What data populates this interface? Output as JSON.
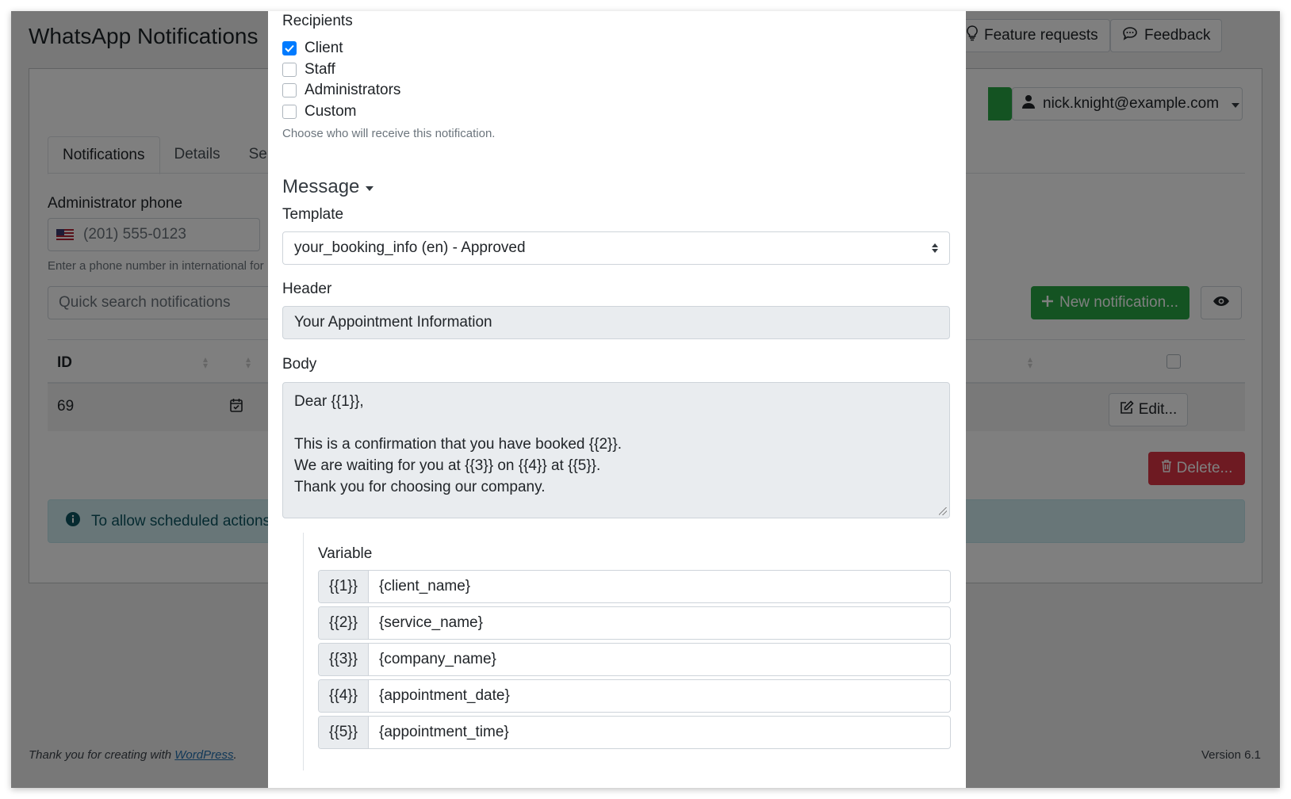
{
  "page": {
    "title": "WhatsApp Notifications",
    "feature_requests": "Feature requests",
    "feedback": "Feedback",
    "user_email": "nick.knight@example.com",
    "tabs": [
      {
        "label": "Notifications"
      },
      {
        "label": "Details"
      },
      {
        "label": "Se"
      }
    ],
    "admin_phone_label": "Administrator phone",
    "admin_phone_placeholder": "(201) 555-0123",
    "phone_help": "Enter a phone number in international for",
    "quick_search_placeholder": "Quick search notifications",
    "new_notification": "New notification...",
    "table": {
      "id_header": "ID",
      "rows": [
        {
          "id": "69",
          "edit": "Edit..."
        }
      ]
    },
    "delete": "Delete...",
    "alert_text": "To allow scheduled actions",
    "footer_text": "Thank you for creating with ",
    "footer_link": "WordPress",
    "footer_period": ".",
    "version": "Version 6.1"
  },
  "modal": {
    "recipients_label": "Recipients",
    "recipients": [
      {
        "label": "Client",
        "checked": true
      },
      {
        "label": "Staff",
        "checked": false
      },
      {
        "label": "Administrators",
        "checked": false
      },
      {
        "label": "Custom",
        "checked": false
      }
    ],
    "recipients_help": "Choose who will receive this notification.",
    "message_title": "Message",
    "template_label": "Template",
    "template_value": "your_booking_info (en) - Approved",
    "header_label": "Header",
    "header_value": "Your Appointment Information",
    "body_label": "Body",
    "body_lines": [
      "Dear {{1}},",
      "",
      "This is a confirmation that you have booked {{2}}.",
      "We are waiting for you at {{3}} on {{4}} at {{5}}.",
      "Thank you for choosing our company."
    ],
    "variable_label": "Variable",
    "variables": [
      {
        "key": "{{1}}",
        "value": "{client_name}"
      },
      {
        "key": "{{2}}",
        "value": "{service_name}"
      },
      {
        "key": "{{3}}",
        "value": "{company_name}"
      },
      {
        "key": "{{4}}",
        "value": "{appointment_date}"
      },
      {
        "key": "{{5}}",
        "value": "{appointment_time}"
      }
    ]
  },
  "colors": {
    "primary": "#007bff",
    "success": "#28a745",
    "danger": "#dc3545",
    "overlay": "rgba(0,0,0,0.5)"
  }
}
